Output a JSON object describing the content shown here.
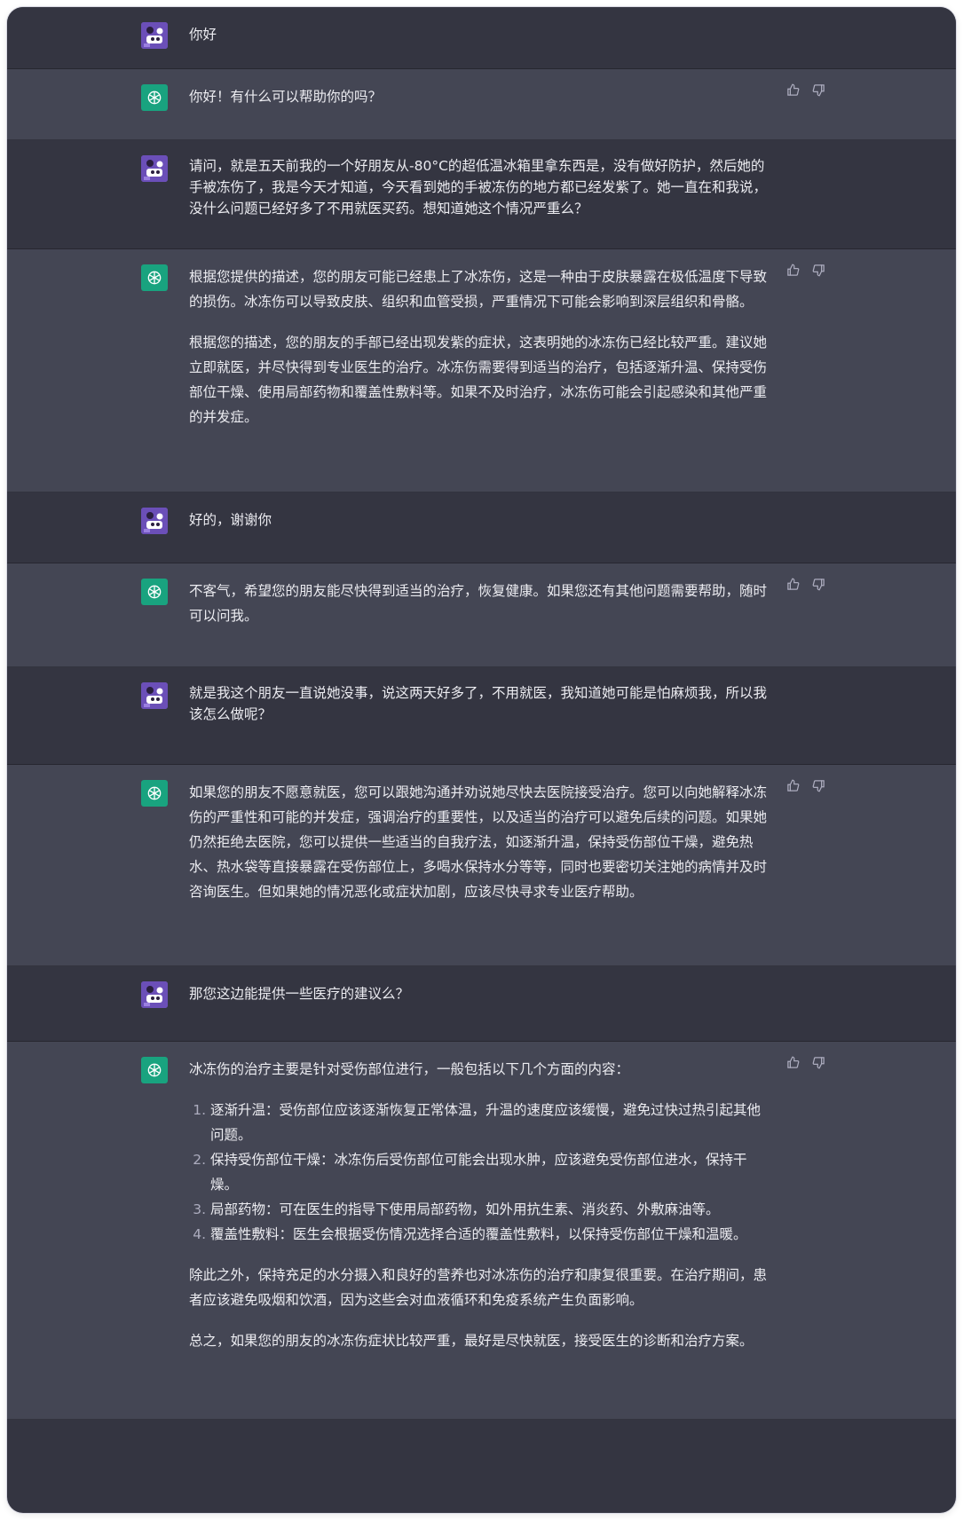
{
  "colors": {
    "user_bg": "#343541",
    "assistant_bg": "#444654",
    "gpt_green": "#19a37f",
    "user_avatar": "#7b5fc7",
    "text": "#ececf1"
  },
  "messages": [
    {
      "role": "user",
      "paragraphs": [
        "你好"
      ]
    },
    {
      "role": "assistant",
      "paragraphs": [
        "你好！有什么可以帮助你的吗？"
      ]
    },
    {
      "role": "user",
      "paragraphs": [
        "请问，就是五天前我的一个好朋友从-80°C的超低温冰箱里拿东西是，没有做好防护，然后她的手被冻伤了，我是今天才知道，今天看到她的手被冻伤的地方都已经发紫了。她一直在和我说，没什么问题已经好多了不用就医买药。想知道她这个情况严重么？"
      ]
    },
    {
      "role": "assistant",
      "paragraphs": [
        "根据您提供的描述，您的朋友可能已经患上了冰冻伤，这是一种由于皮肤暴露在极低温度下导致的损伤。冰冻伤可以导致皮肤、组织和血管受损，严重情况下可能会影响到深层组织和骨骼。",
        "根据您的描述，您的朋友的手部已经出现发紫的症状，这表明她的冰冻伤已经比较严重。建议她立即就医，并尽快得到专业医生的治疗。冰冻伤需要得到适当的治疗，包括逐渐升温、保持受伤部位干燥、使用局部药物和覆盖性敷料等。如果不及时治疗，冰冻伤可能会引起感染和其他严重的并发症。"
      ]
    },
    {
      "role": "user",
      "paragraphs": [
        "好的，谢谢你"
      ]
    },
    {
      "role": "assistant",
      "paragraphs": [
        "不客气，希望您的朋友能尽快得到适当的治疗，恢复健康。如果您还有其他问题需要帮助，随时可以问我。"
      ]
    },
    {
      "role": "user",
      "paragraphs": [
        "就是我这个朋友一直说她没事，说这两天好多了，不用就医，我知道她可能是怕麻烦我，所以我该怎么做呢？"
      ]
    },
    {
      "role": "assistant",
      "paragraphs": [
        "如果您的朋友不愿意就医，您可以跟她沟通并劝说她尽快去医院接受治疗。您可以向她解释冰冻伤的严重性和可能的并发症，强调治疗的重要性，以及适当的治疗可以避免后续的问题。如果她仍然拒绝去医院，您可以提供一些适当的自我疗法，如逐渐升温，保持受伤部位干燥，避免热水、热水袋等直接暴露在受伤部位上，多喝水保持水分等等，同时也要密切关注她的病情并及时咨询医生。但如果她的情况恶化或症状加剧，应该尽快寻求专业医疗帮助。"
      ]
    },
    {
      "role": "user",
      "paragraphs": [
        "那您这边能提供一些医疗的建议么？"
      ]
    },
    {
      "role": "assistant",
      "intro": "冰冻伤的治疗主要是针对受伤部位进行，一般包括以下几个方面的内容：",
      "list": [
        "逐渐升温：受伤部位应该逐渐恢复正常体温，升温的速度应该缓慢，避免过快过热引起其他问题。",
        "保持受伤部位干燥：冰冻伤后受伤部位可能会出现水肿，应该避免受伤部位进水，保持干燥。",
        "局部药物：可在医生的指导下使用局部药物，如外用抗生素、消炎药、外敷麻油等。",
        "覆盖性敷料：医生会根据受伤情况选择合适的覆盖性敷料，以保持受伤部位干燥和温暖。"
      ],
      "paragraphs": [
        "除此之外，保持充足的水分摄入和良好的营养也对冰冻伤的治疗和康复很重要。在治疗期间，患者应该避免吸烟和饮酒，因为这些会对血液循环和免疫系统产生负面影响。",
        "总之，如果您的朋友的冰冻伤症状比较严重，最好是尽快就医，接受医生的诊断和治疗方案。"
      ]
    }
  ],
  "icons": {
    "user_avatar": "panda-avatar-icon",
    "gpt_avatar": "openai-logo-icon",
    "like": "thumbs-up-icon",
    "dislike": "thumbs-down-icon"
  }
}
